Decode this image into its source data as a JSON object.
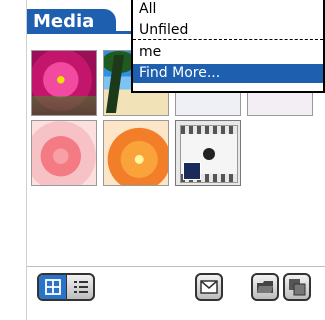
{
  "app": {
    "title": "Media"
  },
  "category_menu": {
    "items": [
      {
        "label": "All"
      },
      {
        "label": "Unfiled"
      },
      {
        "label": "me"
      },
      {
        "label": "Find More..."
      }
    ]
  },
  "toolbar": {
    "view_icons": [
      "grid-view-icon",
      "list-view-icon"
    ],
    "buttons": [
      "mail-icon",
      "folder-icon",
      "copy-icon"
    ]
  },
  "colors": {
    "accent": "#1f5fb0",
    "selected": "#1f5fb0"
  }
}
